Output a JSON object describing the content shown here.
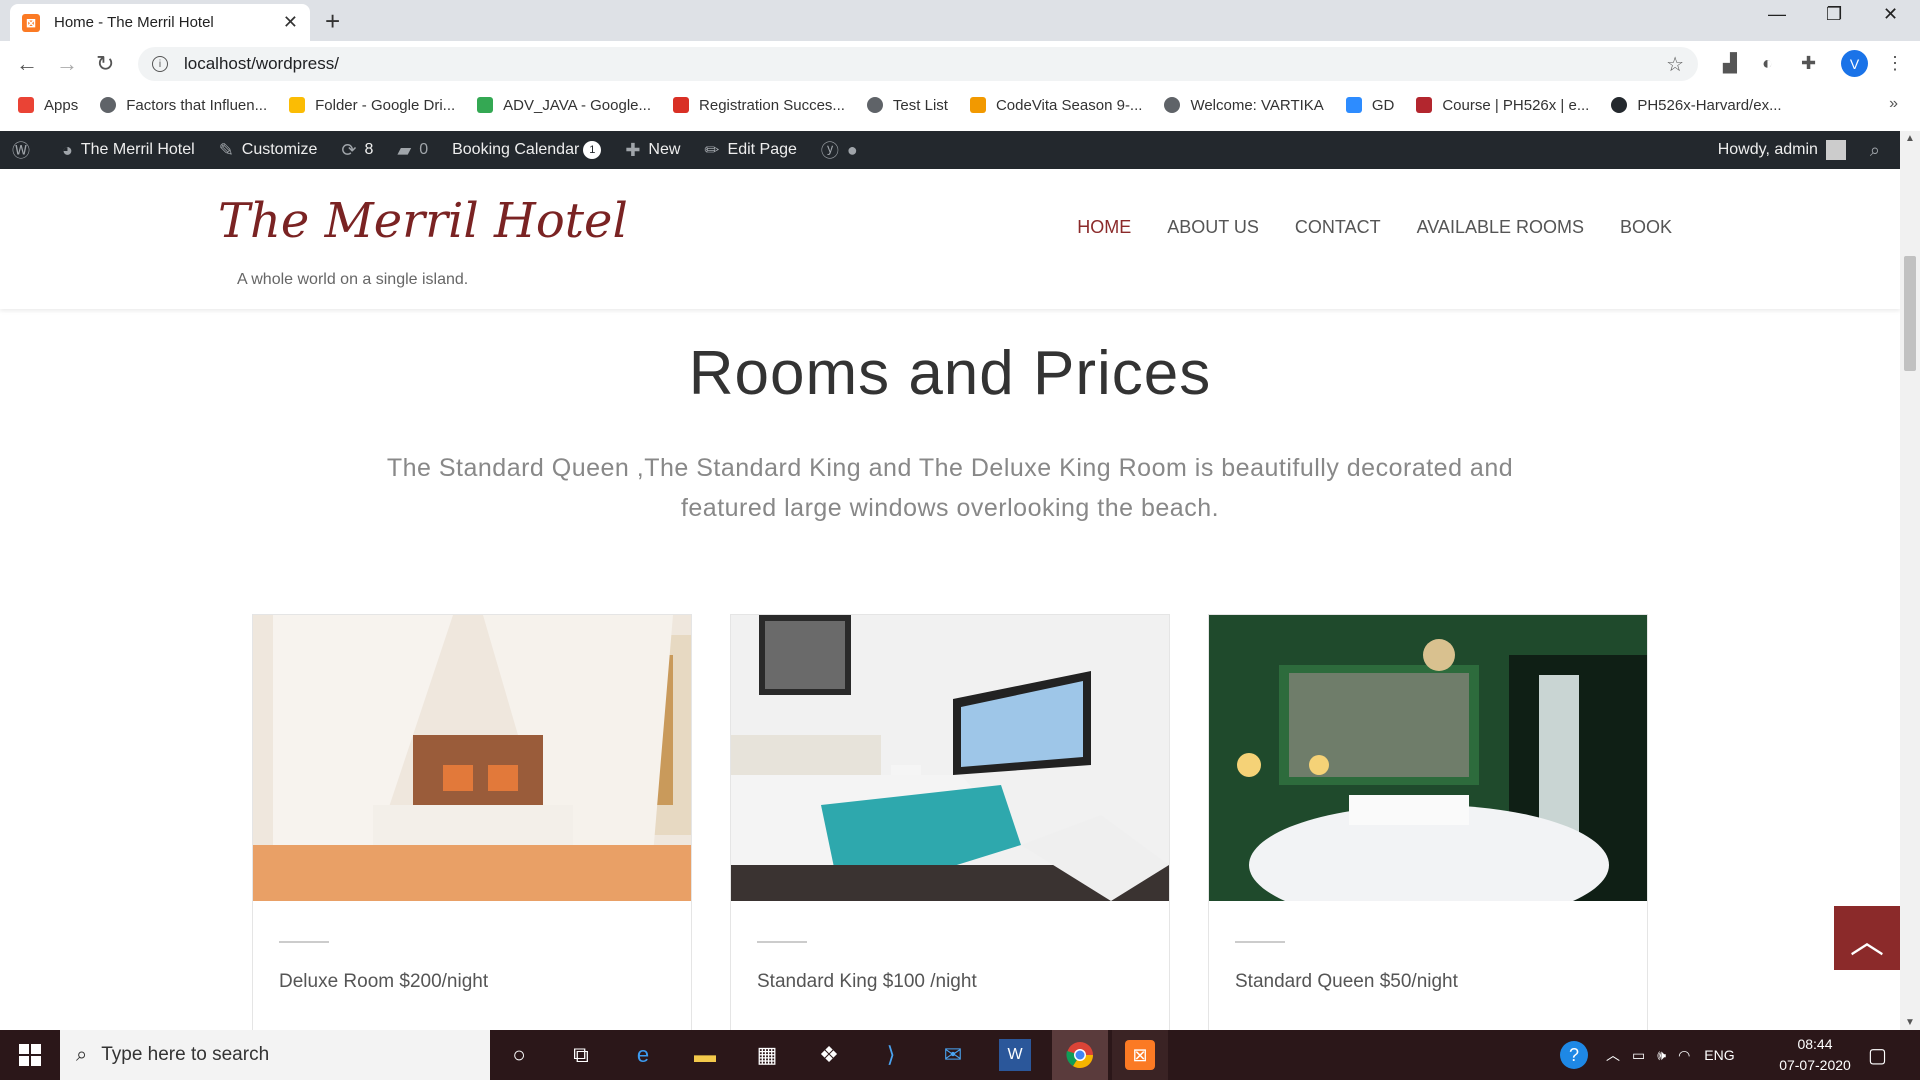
{
  "browser": {
    "tab_title": "Home - The Merril Hotel",
    "url": "localhost/wordpress/",
    "profile_initial": "V"
  },
  "bookmarks": [
    {
      "label": "Apps",
      "color": "#ea4335"
    },
    {
      "label": "Factors that Influen...",
      "color": "#5f6368"
    },
    {
      "label": "Folder - Google Dri...",
      "color": "#fbbc04"
    },
    {
      "label": "ADV_JAVA - Google...",
      "color": "#34a853"
    },
    {
      "label": "Registration Succes...",
      "color": "#d93025"
    },
    {
      "label": "Test List",
      "color": "#5f6368"
    },
    {
      "label": "CodeVita Season 9-...",
      "color": "#f29900"
    },
    {
      "label": "Welcome: VARTIKA",
      "color": "#5f6368"
    },
    {
      "label": "GD",
      "color": "#2d8cff"
    },
    {
      "label": "Course | PH526x | e...",
      "color": "#b3262e"
    },
    {
      "label": "PH526x-Harvard/ex...",
      "color": "#24292e"
    }
  ],
  "adminbar": {
    "site_name": "The Merril Hotel",
    "customize": "Customize",
    "updates_count": "8",
    "comments_count": "0",
    "booking_calendar": "Booking Calendar",
    "booking_badge": "1",
    "new": "New",
    "edit_page": "Edit Page",
    "howdy": "Howdy, admin"
  },
  "site": {
    "title": "The Merril Hotel",
    "tagline": "A whole world on a single island.",
    "nav": [
      "HOME",
      "ABOUT US",
      "CONTACT",
      "AVAILABLE ROOMS",
      "BOOK"
    ]
  },
  "section": {
    "title": "Rooms and Prices",
    "description": "The Standard Queen ,The Standard King and The Deluxe King Room is beautifully decorated and featured large windows overlooking the beach."
  },
  "rooms": [
    {
      "title": "Deluxe Room $200/night"
    },
    {
      "title": "Standard King $100 /night"
    },
    {
      "title": "Standard Queen $50/night"
    }
  ],
  "taskbar": {
    "search_placeholder": "Type here to search",
    "language": "ENG",
    "time": "08:44",
    "date": "07-07-2020"
  },
  "colors": {
    "accent": "#8b2a2a",
    "admin_bar": "#23282d",
    "taskbar": "#2b1719"
  }
}
